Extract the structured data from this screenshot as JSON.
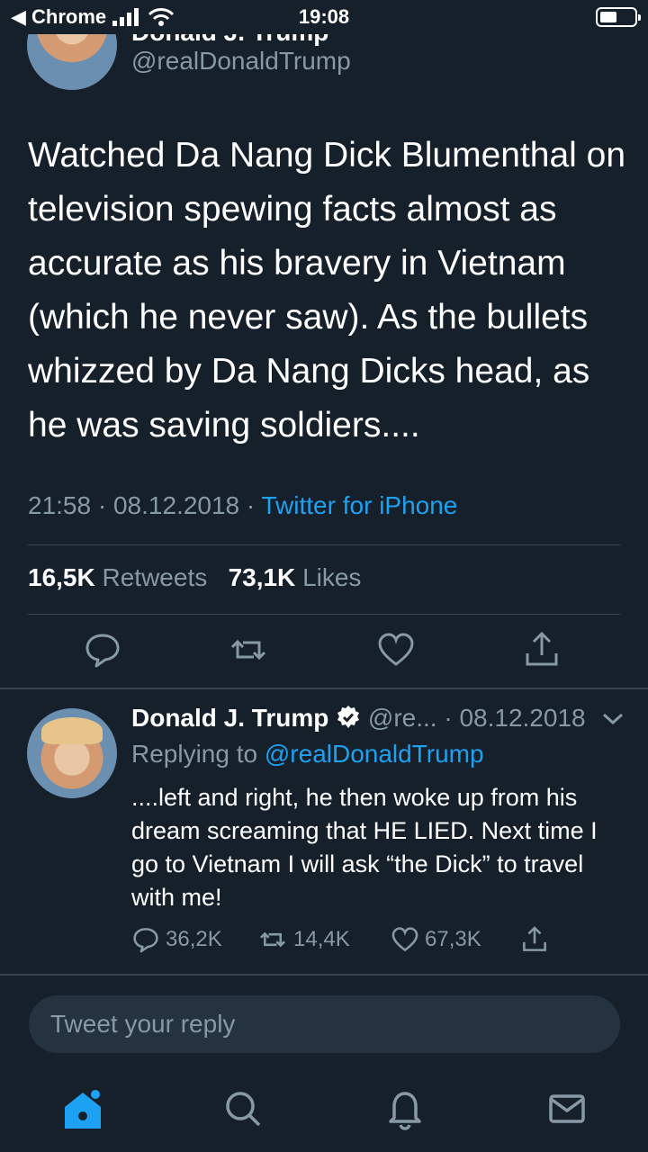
{
  "status": {
    "back_label": "◀ Chrome",
    "time": "19:08"
  },
  "header": {
    "name": "Donald J. Trump",
    "handle": "@realDonaldTrump"
  },
  "tweet": {
    "text": "Watched Da Nang Dick Blumenthal on television spewing facts almost as accurate as his bravery in Vietnam (which he never saw). As the bullets whizzed by Da Nang Dicks head, as he was saving soldiers....",
    "time": "21:58",
    "date": "08.12.2018",
    "source": "Twitter for iPhone",
    "retweets_count": "16,5K",
    "retweets_label": "Retweets",
    "likes_count": "73,1K",
    "likes_label": "Likes"
  },
  "reply": {
    "name": "Donald J. Trump",
    "handle_date": "@re... · 08.12.2018",
    "replying_prefix": "Replying to",
    "replying_mention": "@realDonaldTrump",
    "text": "....left and right, he then woke up from his dream screaming that HE LIED. Next time I go to Vietnam I will ask “the Dick” to travel with me!",
    "replies": "36,2K",
    "retweets": "14,4K",
    "likes": "67,3K"
  },
  "composer": {
    "placeholder": "Tweet your reply"
  },
  "colors": {
    "background": "#15202b",
    "secondary_text": "#8899a6",
    "accent": "#1da1f2",
    "divider": "#38444d"
  }
}
